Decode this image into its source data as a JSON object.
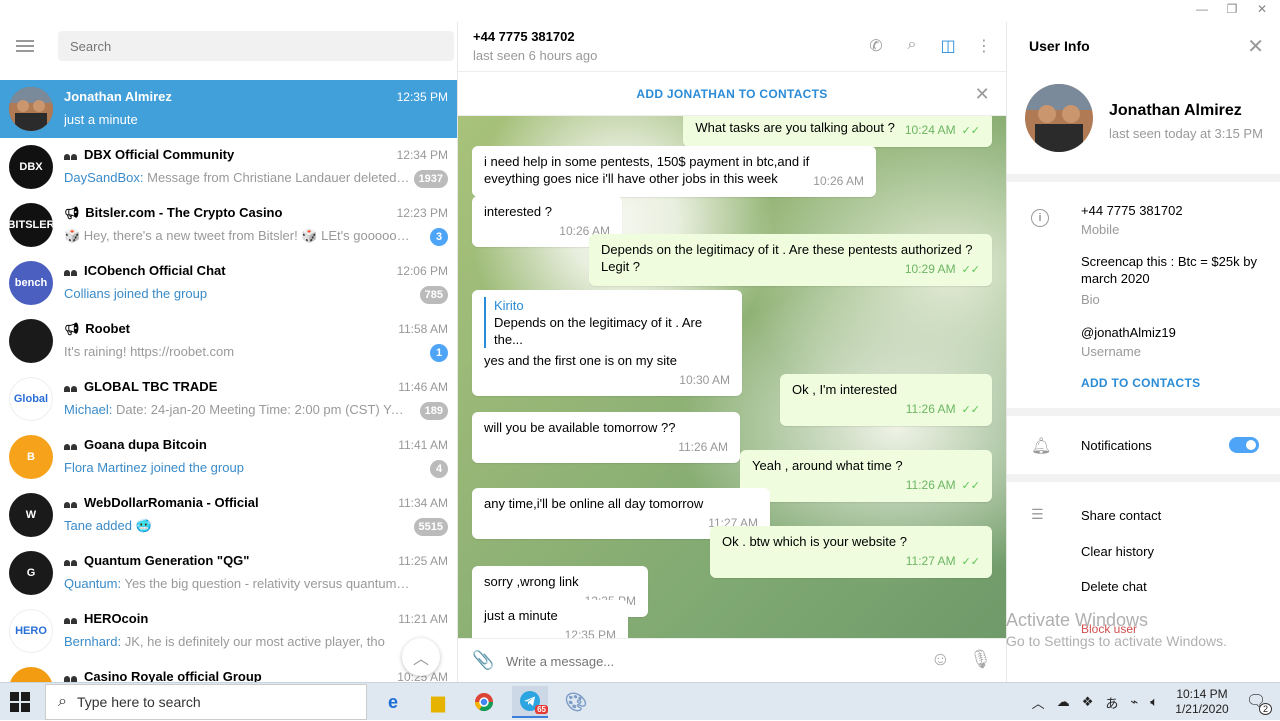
{
  "search": {
    "placeholder": "Search"
  },
  "chats": [
    {
      "name": "Jonathan Almirez",
      "time": "12:35 PM",
      "preview": "just a minute",
      "sender": "",
      "badge": "",
      "type": "user",
      "avatar_color": "#8a5a3c",
      "avatar_text": ""
    },
    {
      "name": "DBX Official Community",
      "time": "12:34 PM",
      "preview": "Message from Christiane Landauer deleted. Re...",
      "sender": "DaySandBox: ",
      "badge": "1937",
      "type": "group",
      "avatar_color": "#111111",
      "avatar_text": "DBX"
    },
    {
      "name": "Bitsler.com - The Crypto Casino",
      "time": "12:23 PM",
      "preview": "🎲 Hey, there's a new tweet from Bitsler! 🎲 LEt's goooooo!!!! ...",
      "sender": "",
      "badge": "3",
      "type": "channel",
      "avatar_color": "#111111",
      "avatar_text": "BITSLER"
    },
    {
      "name": "ICObench Official Chat",
      "time": "12:06 PM",
      "preview": "Collians joined the group",
      "sender": "",
      "badge": "785",
      "type": "group",
      "avatar_color": "#4a5fbf",
      "avatar_text": "bench",
      "preview_blue": true
    },
    {
      "name": "Roobet",
      "time": "11:58 AM",
      "preview": "It's raining!  https://roobet.com",
      "sender": "",
      "badge": "1",
      "type": "channel",
      "avatar_color": "#1a1a1a",
      "avatar_text": "",
      "badge_blue": true
    },
    {
      "name": "GLOBAL TBC TRADE",
      "time": "11:46 AM",
      "preview": "Date: 24-jan-20 Meeting Time: 2:00 pm (CST)  You can...",
      "sender": "Michael: ",
      "badge": "189",
      "type": "group",
      "avatar_color": "#ffffff",
      "avatar_text": "Global"
    },
    {
      "name": "Goana dupa Bitcoin",
      "time": "11:41 AM",
      "preview": "Flora Martinez joined the group",
      "sender": "",
      "badge": "4",
      "type": "group",
      "avatar_color": "#f7a21b",
      "avatar_text": "B",
      "preview_blue": true
    },
    {
      "name": "WebDollarRomania - Official",
      "time": "11:34 AM",
      "preview": "Tane added 🥶",
      "sender": "",
      "badge": "5515",
      "type": "group",
      "avatar_color": "#1a1a1a",
      "avatar_text": "W",
      "preview_blue": true
    },
    {
      "name": "Quantum Generation \"QG\"",
      "time": "11:25 AM",
      "preview": "Yes the big question - relativity versus quantum mechani...",
      "sender": "Quantum: ",
      "badge": "",
      "type": "group",
      "avatar_color": "#1a1a1a",
      "avatar_text": "G"
    },
    {
      "name": "HEROcoin",
      "time": "11:21 AM",
      "preview": "JK, he is definitely our most active player, tho",
      "sender": "Bernhard: ",
      "badge": "",
      "type": "group",
      "avatar_color": "#ffffff",
      "avatar_text": "HERO"
    },
    {
      "name": "Casino Royale official Group",
      "time": "10:25 AM",
      "preview": "",
      "sender": "",
      "badge": "",
      "type": "group",
      "avatar_color": "#f39c12",
      "avatar_text": ""
    }
  ],
  "conversation": {
    "title": "+44 7775 381702",
    "status": "last seen 6 hours ago",
    "add_bar": "ADD JONATHAN TO CONTACTS",
    "reply_name": "Kirito",
    "reply_text": "Depends on the legitimacy of it .  Are the...",
    "input_placeholder": "Write a message...",
    "messages": [
      {
        "text": "What tasks are you talking about ?",
        "time": "10:24 AM",
        "out": true
      },
      {
        "text": "i need help in some pentests, 150$ payment in btc,and if eveything goes nice i'll have other jobs in this week",
        "time": "10:26 AM",
        "out": false
      },
      {
        "text": "interested ?",
        "time": "10:26 AM",
        "out": false
      },
      {
        "text": "Depends on the legitimacy of it .  Are these pentests authorized ? Legit ?",
        "time": "10:29 AM",
        "out": true
      },
      {
        "text": "yes and the first one is on my site",
        "time": "10:30 AM",
        "out": false
      },
      {
        "text": "Ok , I'm interested",
        "time": "11:26 AM",
        "out": true
      },
      {
        "text": "will you be available tomorrow ??",
        "time": "11:26 AM",
        "out": false
      },
      {
        "text": "Yeah , around what time ?",
        "time": "11:26 AM",
        "out": true
      },
      {
        "text": "any time,i'll be online all day tomorrow",
        "time": "11:27 AM",
        "out": false
      },
      {
        "text": "Ok . btw which is your website ?",
        "time": "11:27 AM",
        "out": true
      },
      {
        "text": "sorry ,wrong link",
        "time": "12:35 PM",
        "out": false
      },
      {
        "text": "just a minute",
        "time": "12:35 PM",
        "out": false
      }
    ]
  },
  "user_info": {
    "title": "User Info",
    "name": "Jonathan Almirez",
    "seen": "last seen today at 3:15 PM",
    "phone": "+44 7775 381702",
    "phone_label": "Mobile",
    "bio": "Screencap this : Btc = $25k by march 2020",
    "bio_label": "Bio",
    "username": "@jonathAlmiz19",
    "username_label": "Username",
    "add_contacts": "ADD TO CONTACTS",
    "notifications": "Notifications",
    "notifications_on": true,
    "share": "Share contact",
    "clear": "Clear history",
    "delete": "Delete chat",
    "block": "Block user"
  },
  "watermark": {
    "line1": "Activate Windows",
    "line2": "Go to Settings to activate Windows."
  },
  "taskbar": {
    "search_text": "Type here to search",
    "time": "10:14 PM",
    "date": "1/21/2020",
    "telegram_badge": "65",
    "notif_count": "2"
  }
}
